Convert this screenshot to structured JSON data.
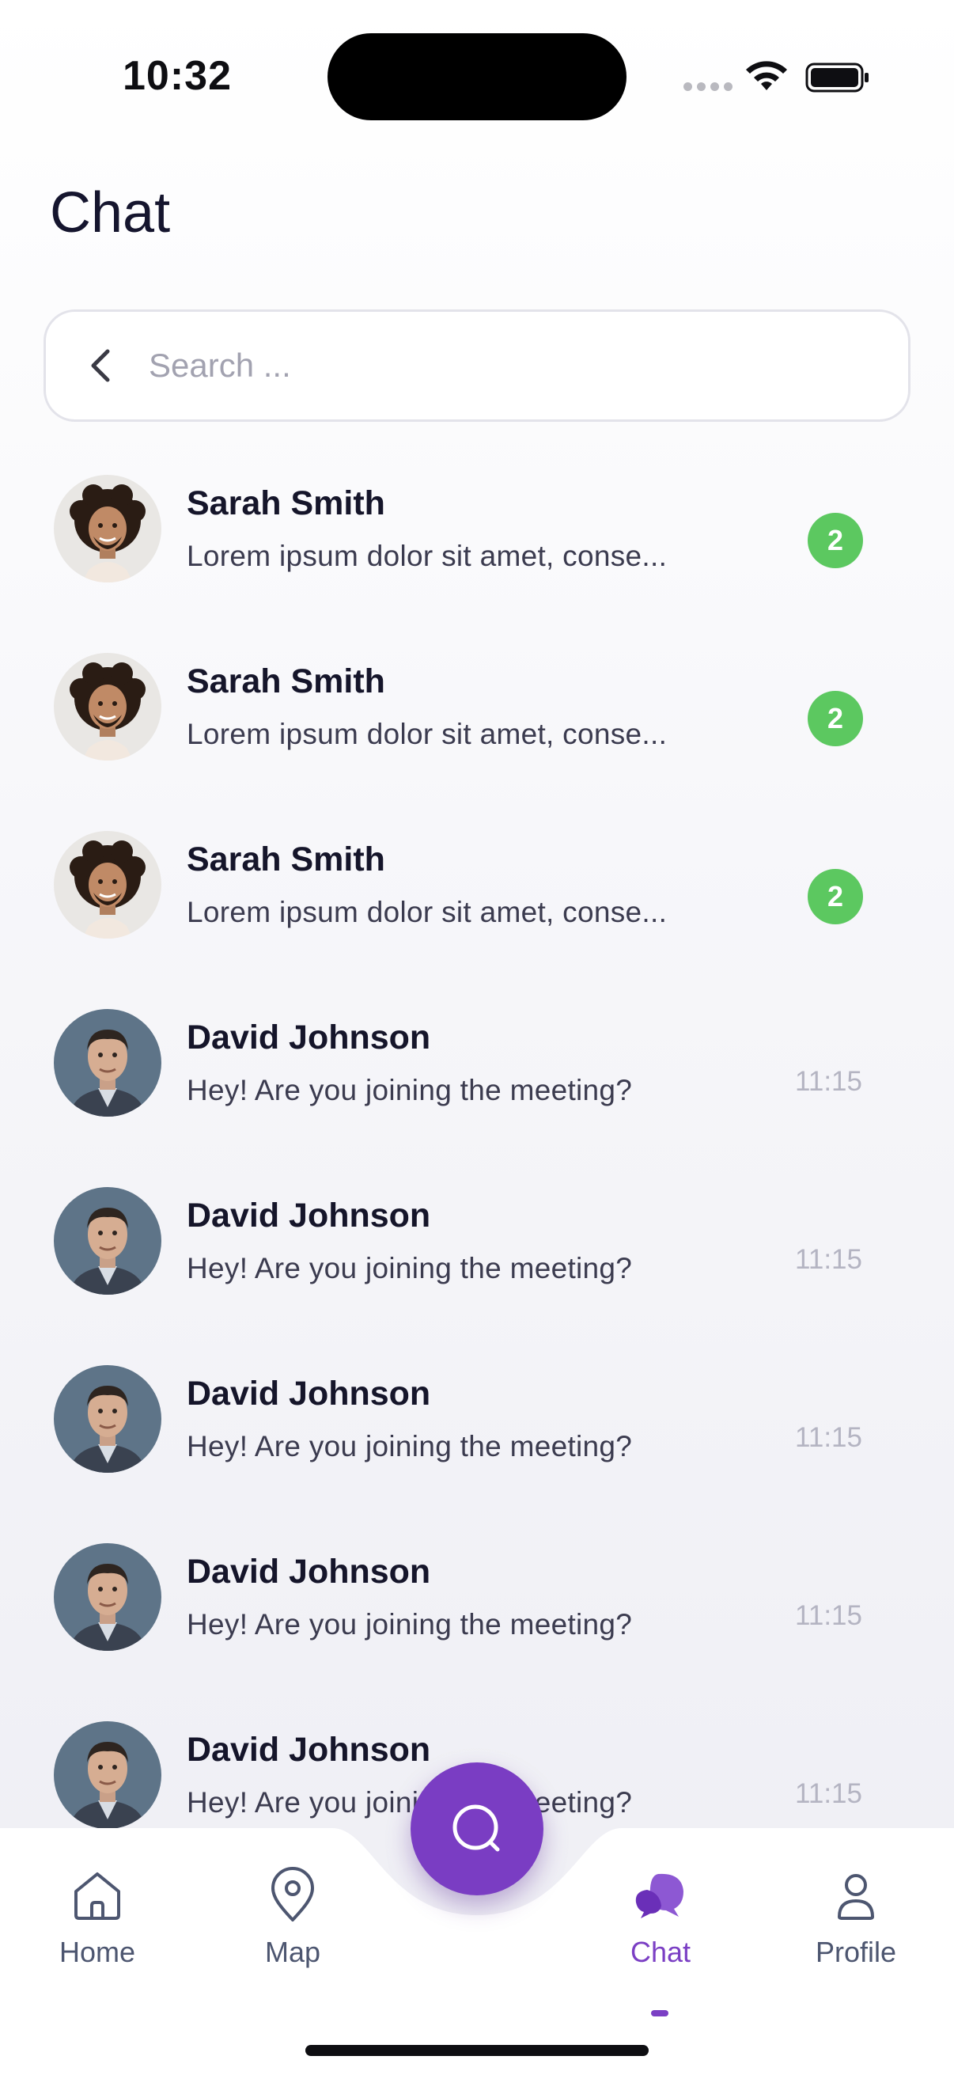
{
  "status_bar": {
    "time": "10:32"
  },
  "header": {
    "title": "Chat"
  },
  "search": {
    "placeholder": "Search ..."
  },
  "chats": [
    {
      "name": "Sarah Smith",
      "preview": "Lorem ipsum dolor sit amet, conse...",
      "unread": "2",
      "avatar": "curly-hair-man"
    },
    {
      "name": "Sarah Smith",
      "preview": "Lorem ipsum dolor sit amet, conse...",
      "unread": "2",
      "avatar": "curly-hair-man"
    },
    {
      "name": "Sarah Smith",
      "preview": "Lorem ipsum dolor sit amet, conse...",
      "unread": "2",
      "avatar": "curly-hair-man"
    },
    {
      "name": "David Johnson",
      "preview": "Hey! Are you joining the meeting?",
      "time": "11:15",
      "avatar": "suited-man"
    },
    {
      "name": "David Johnson",
      "preview": "Hey! Are you joining the meeting?",
      "time": "11:15",
      "avatar": "suited-man"
    },
    {
      "name": "David Johnson",
      "preview": "Hey! Are you joining the meeting?",
      "time": "11:15",
      "avatar": "suited-man"
    },
    {
      "name": "David Johnson",
      "preview": "Hey! Are you joining the meeting?",
      "time": "11:15",
      "avatar": "suited-man"
    },
    {
      "name": "David Johnson",
      "preview": "Hey! Are you joining the meeting?",
      "time": "11:15",
      "avatar": "suited-man"
    }
  ],
  "nav": {
    "home": "Home",
    "map": "Map",
    "chat": "Chat",
    "profile": "Profile",
    "active": "chat",
    "fab_icon": "search-icon"
  },
  "colors": {
    "accent": "#7a3dc3",
    "badge": "#5cc860",
    "nav_inactive": "#4d5670"
  }
}
